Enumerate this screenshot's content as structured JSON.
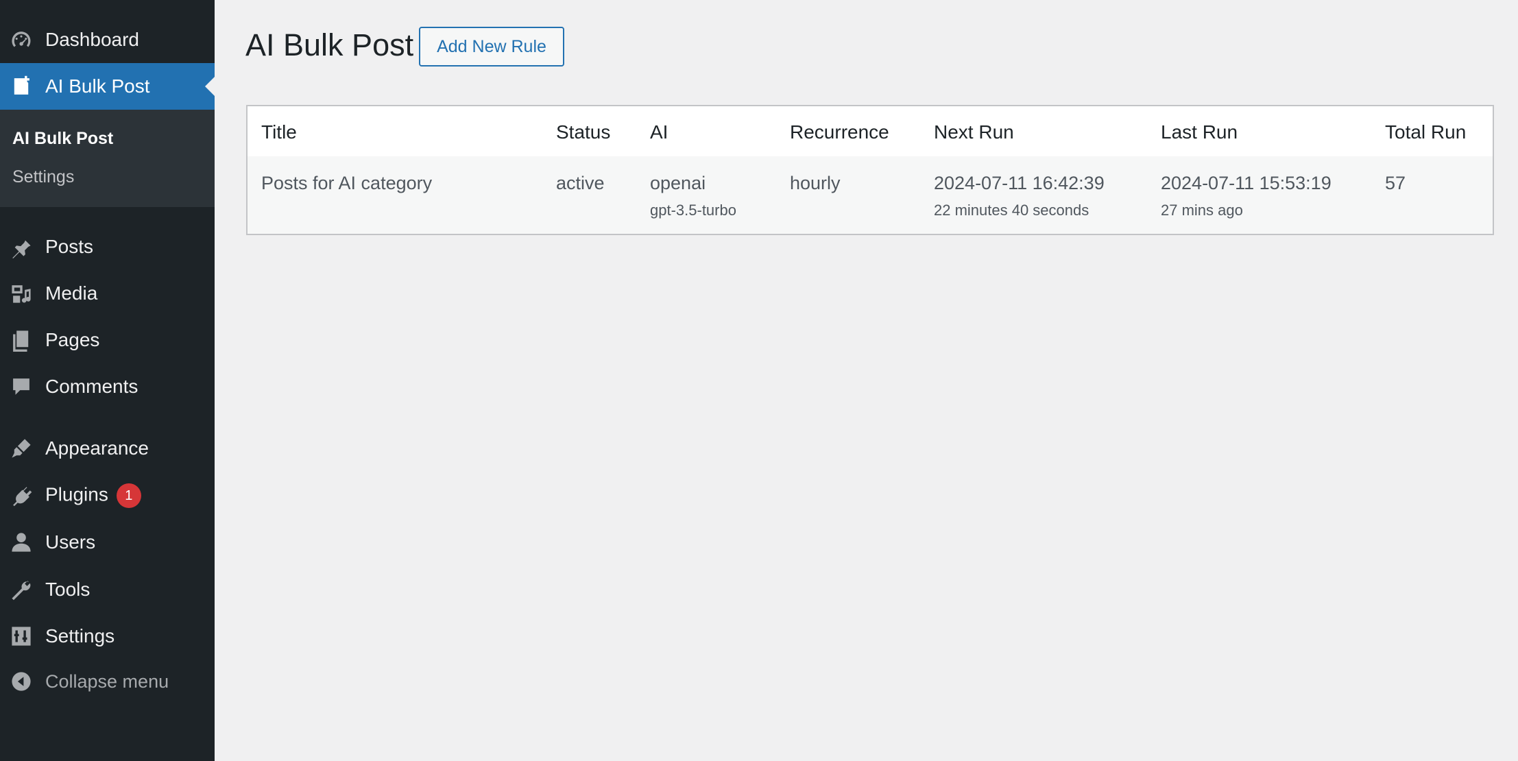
{
  "sidebar": {
    "items": [
      {
        "label": "Dashboard",
        "icon": "dashboard-icon"
      },
      {
        "label": "AI Bulk Post",
        "icon": "ai-bulk-post-icon"
      },
      {
        "label": "Posts",
        "icon": "pin-icon"
      },
      {
        "label": "Media",
        "icon": "media-icon"
      },
      {
        "label": "Pages",
        "icon": "pages-icon"
      },
      {
        "label": "Comments",
        "icon": "comment-icon"
      },
      {
        "label": "Appearance",
        "icon": "paintbrush-icon"
      },
      {
        "label": "Plugins",
        "icon": "plugin-icon",
        "badge": "1"
      },
      {
        "label": "Users",
        "icon": "user-icon"
      },
      {
        "label": "Tools",
        "icon": "wrench-icon"
      },
      {
        "label": "Settings",
        "icon": "settings-icon"
      }
    ],
    "submenu": [
      "AI Bulk Post",
      "Settings"
    ],
    "collapse_label": "Collapse menu"
  },
  "page": {
    "title": "AI Bulk Post",
    "add_button": "Add New Rule"
  },
  "table": {
    "columns": [
      "Title",
      "Status",
      "AI",
      "Recurrence",
      "Next Run",
      "Last Run",
      "Total Run"
    ],
    "rows": [
      {
        "title": "Posts for AI category",
        "status": "active",
        "ai": "openai",
        "model": "gpt-3.5-turbo",
        "recurrence": "hourly",
        "next_run": "2024-07-11 16:42:39",
        "next_run_relative": "22 minutes 40 seconds",
        "last_run": "2024-07-11 15:53:19",
        "last_run_relative": "27 mins ago",
        "total_run": "57"
      }
    ]
  },
  "colors": {
    "sidebar_bg": "#1d2327",
    "submenu_bg": "#2c3338",
    "accent": "#2271b1",
    "badge": "#d63638",
    "page_bg": "#f0f0f1"
  }
}
